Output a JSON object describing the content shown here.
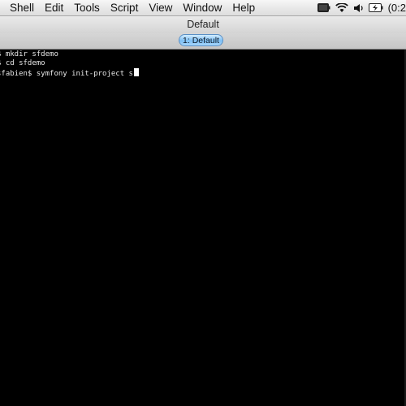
{
  "menubar": {
    "items": [
      {
        "label": "Shell"
      },
      {
        "label": "Edit"
      },
      {
        "label": "Tools"
      },
      {
        "label": "Script"
      },
      {
        "label": "View"
      },
      {
        "label": "Window"
      },
      {
        "label": "Help"
      }
    ],
    "status_icons": [
      "battery-icon",
      "wifi-icon",
      "volume-icon",
      "battery-charging-icon"
    ],
    "clock": "(0:2"
  },
  "window": {
    "title": "Default"
  },
  "tabs": [
    {
      "label": "1: Default",
      "active": true
    }
  ],
  "terminal": {
    "lines": [
      "$ mkdir sfdemo",
      "$ cd sfdemo",
      "sfabien$ symfony init-project s"
    ],
    "text_color": "#e8e8e8",
    "background": "#000000"
  },
  "colors": {
    "tab_active": "#7ec0f5",
    "menubar_bg": "#e6e6e6"
  }
}
